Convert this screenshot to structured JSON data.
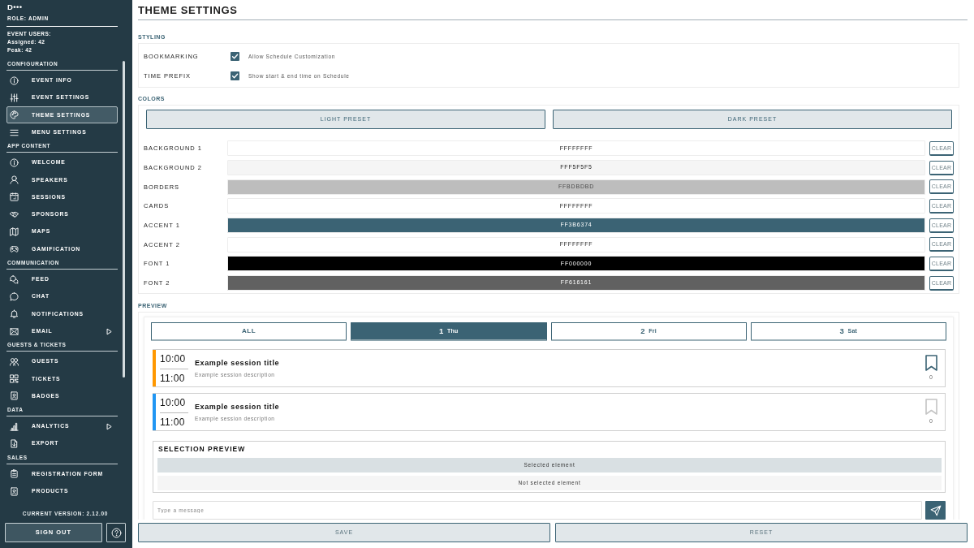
{
  "sidebar": {
    "user": {
      "name": "D•••",
      "role": "ROLE: ADMIN"
    },
    "event_users": {
      "heading": "EVENT USERS:",
      "assigned": "Assigned: 42",
      "peak": "Peak: 42"
    },
    "sections": [
      {
        "title": "CONFIGURATION",
        "items": [
          {
            "label": "EVENT INFO",
            "selected": false,
            "submenu": false
          },
          {
            "label": "EVENT SETTINGS",
            "selected": false,
            "submenu": false
          },
          {
            "label": "THEME SETTINGS",
            "selected": true,
            "submenu": false
          },
          {
            "label": "MENU SETTINGS",
            "selected": false,
            "submenu": false
          }
        ]
      },
      {
        "title": "APP CONTENT",
        "items": [
          {
            "label": "WELCOME",
            "selected": false,
            "submenu": false
          },
          {
            "label": "SPEAKERS",
            "selected": false,
            "submenu": false
          },
          {
            "label": "SESSIONS",
            "selected": false,
            "submenu": false
          },
          {
            "label": "SPONSORS",
            "selected": false,
            "submenu": false
          },
          {
            "label": "MAPS",
            "selected": false,
            "submenu": false
          },
          {
            "label": "GAMIFICATION",
            "selected": false,
            "submenu": false
          }
        ]
      },
      {
        "title": "COMMUNICATION",
        "items": [
          {
            "label": "FEED",
            "selected": false,
            "submenu": false
          },
          {
            "label": "CHAT",
            "selected": false,
            "submenu": false
          },
          {
            "label": "NOTIFICATIONS",
            "selected": false,
            "submenu": false
          },
          {
            "label": "EMAIL",
            "selected": false,
            "submenu": true
          }
        ]
      },
      {
        "title": "GUESTS & TICKETS",
        "items": [
          {
            "label": "GUESTS",
            "selected": false,
            "submenu": false
          },
          {
            "label": "TICKETS",
            "selected": false,
            "submenu": false
          },
          {
            "label": "BADGES",
            "selected": false,
            "submenu": false
          }
        ]
      },
      {
        "title": "DATA",
        "items": [
          {
            "label": "ANALYTICS",
            "selected": false,
            "submenu": true
          },
          {
            "label": "EXPORT",
            "selected": false,
            "submenu": false
          }
        ]
      },
      {
        "title": "SALES",
        "items": [
          {
            "label": "REGISTRATION FORM",
            "selected": false,
            "submenu": false
          },
          {
            "label": "PRODUCTS",
            "selected": false,
            "submenu": false
          }
        ]
      }
    ],
    "version": "CURRENT VERSION: 2.12.00",
    "sign_out": "SIGN OUT"
  },
  "page": {
    "title": "THEME SETTINGS"
  },
  "styling": {
    "heading": "STYLING",
    "options": [
      {
        "label": "BOOKMARKING",
        "checked": true,
        "text": "Allow Schedule Customization"
      },
      {
        "label": "TIME PREFIX",
        "checked": true,
        "text": "Show start & end time on Schedule"
      }
    ]
  },
  "colors": {
    "heading": "COLORS",
    "presets": [
      "LIGHT PRESET",
      "DARK PRESET"
    ],
    "rows": [
      {
        "label": "BACKGROUND 1",
        "value": "FFFFFFFF",
        "color": "#ffffff",
        "clear": "CLEAR"
      },
      {
        "label": "BACKGROUND 2",
        "value": "FFF5F5F5",
        "color": "#f5f5f5",
        "clear": "CLEAR"
      },
      {
        "label": "BORDERS",
        "value": "FFBDBDBD",
        "color": "#bdbdbd",
        "clear": "CLEAR"
      },
      {
        "label": "CARDS",
        "value": "FFFFFFFF",
        "color": "#ffffff",
        "clear": "CLEAR"
      },
      {
        "label": "ACCENT 1",
        "value": "FF3B6374",
        "color": "#3b6374",
        "clear": "CLEAR"
      },
      {
        "label": "ACCENT 2",
        "value": "FFFFFFFF",
        "color": "#ffffff",
        "clear": "CLEAR"
      },
      {
        "label": "FONT 1",
        "value": "FF000000",
        "color": "#000000",
        "clear": "CLEAR"
      },
      {
        "label": "FONT 2",
        "value": "FF616161",
        "color": "#616161",
        "clear": "CLEAR"
      }
    ]
  },
  "preview": {
    "heading": "PREVIEW",
    "tabs": [
      {
        "label": "ALL",
        "selected": false
      },
      {
        "label": "1",
        "sub": "Thu",
        "selected": true
      },
      {
        "label": "2",
        "sub": "Fri",
        "selected": false
      },
      {
        "label": "3",
        "sub": "Sat",
        "selected": false
      }
    ],
    "sessions": [
      {
        "start": "10:00",
        "end": "11:00",
        "title": "Example session title",
        "description": "Example session description",
        "color": "#ff9800",
        "bookmarked": true,
        "count": "0"
      },
      {
        "start": "10:00",
        "end": "11:00",
        "title": "Example session title",
        "description": "Example session description",
        "color": "#2196f3",
        "bookmarked": false,
        "count": "0"
      }
    ],
    "selection": {
      "title": "SELECTION PREVIEW",
      "rows": [
        {
          "label": "Selected element",
          "selected": true
        },
        {
          "label": "Not selected element",
          "selected": false
        }
      ]
    },
    "message": {
      "placeholder": "Type a message"
    }
  },
  "footer": {
    "buttons": [
      "SAVE",
      "RESET"
    ]
  }
}
